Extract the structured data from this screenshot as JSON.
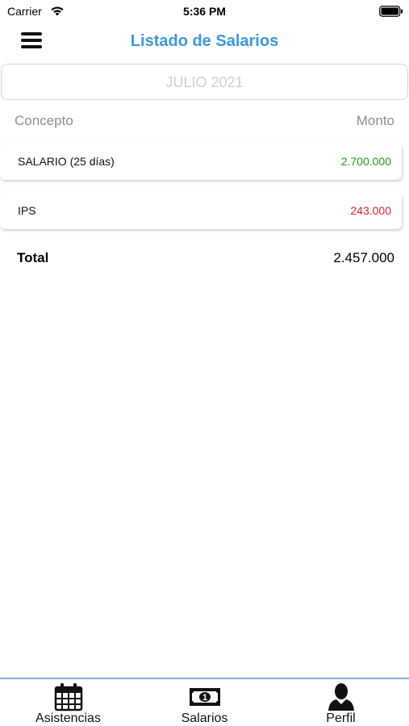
{
  "status_bar": {
    "carrier": "Carrier",
    "time": "5:36 PM"
  },
  "nav": {
    "title": "Listado de Salarios",
    "title_color": "#3b97e3"
  },
  "month_selector": {
    "value": "JULIO 2021"
  },
  "columns": {
    "concept": "Concepto",
    "amount": "Monto"
  },
  "rows": [
    {
      "concept": "SALARIO (25 días)",
      "amount": "2.700.000",
      "color": "#1f9a1f"
    },
    {
      "concept": "IPS",
      "amount": "243.000",
      "color": "#e0202e"
    }
  ],
  "total": {
    "label": "Total",
    "value": "2.457.000"
  },
  "tabs": [
    {
      "label": "Asistencias",
      "icon": "calendar-icon"
    },
    {
      "label": "Salarios",
      "icon": "money-icon"
    },
    {
      "label": "Perfil",
      "icon": "user-icon"
    }
  ]
}
